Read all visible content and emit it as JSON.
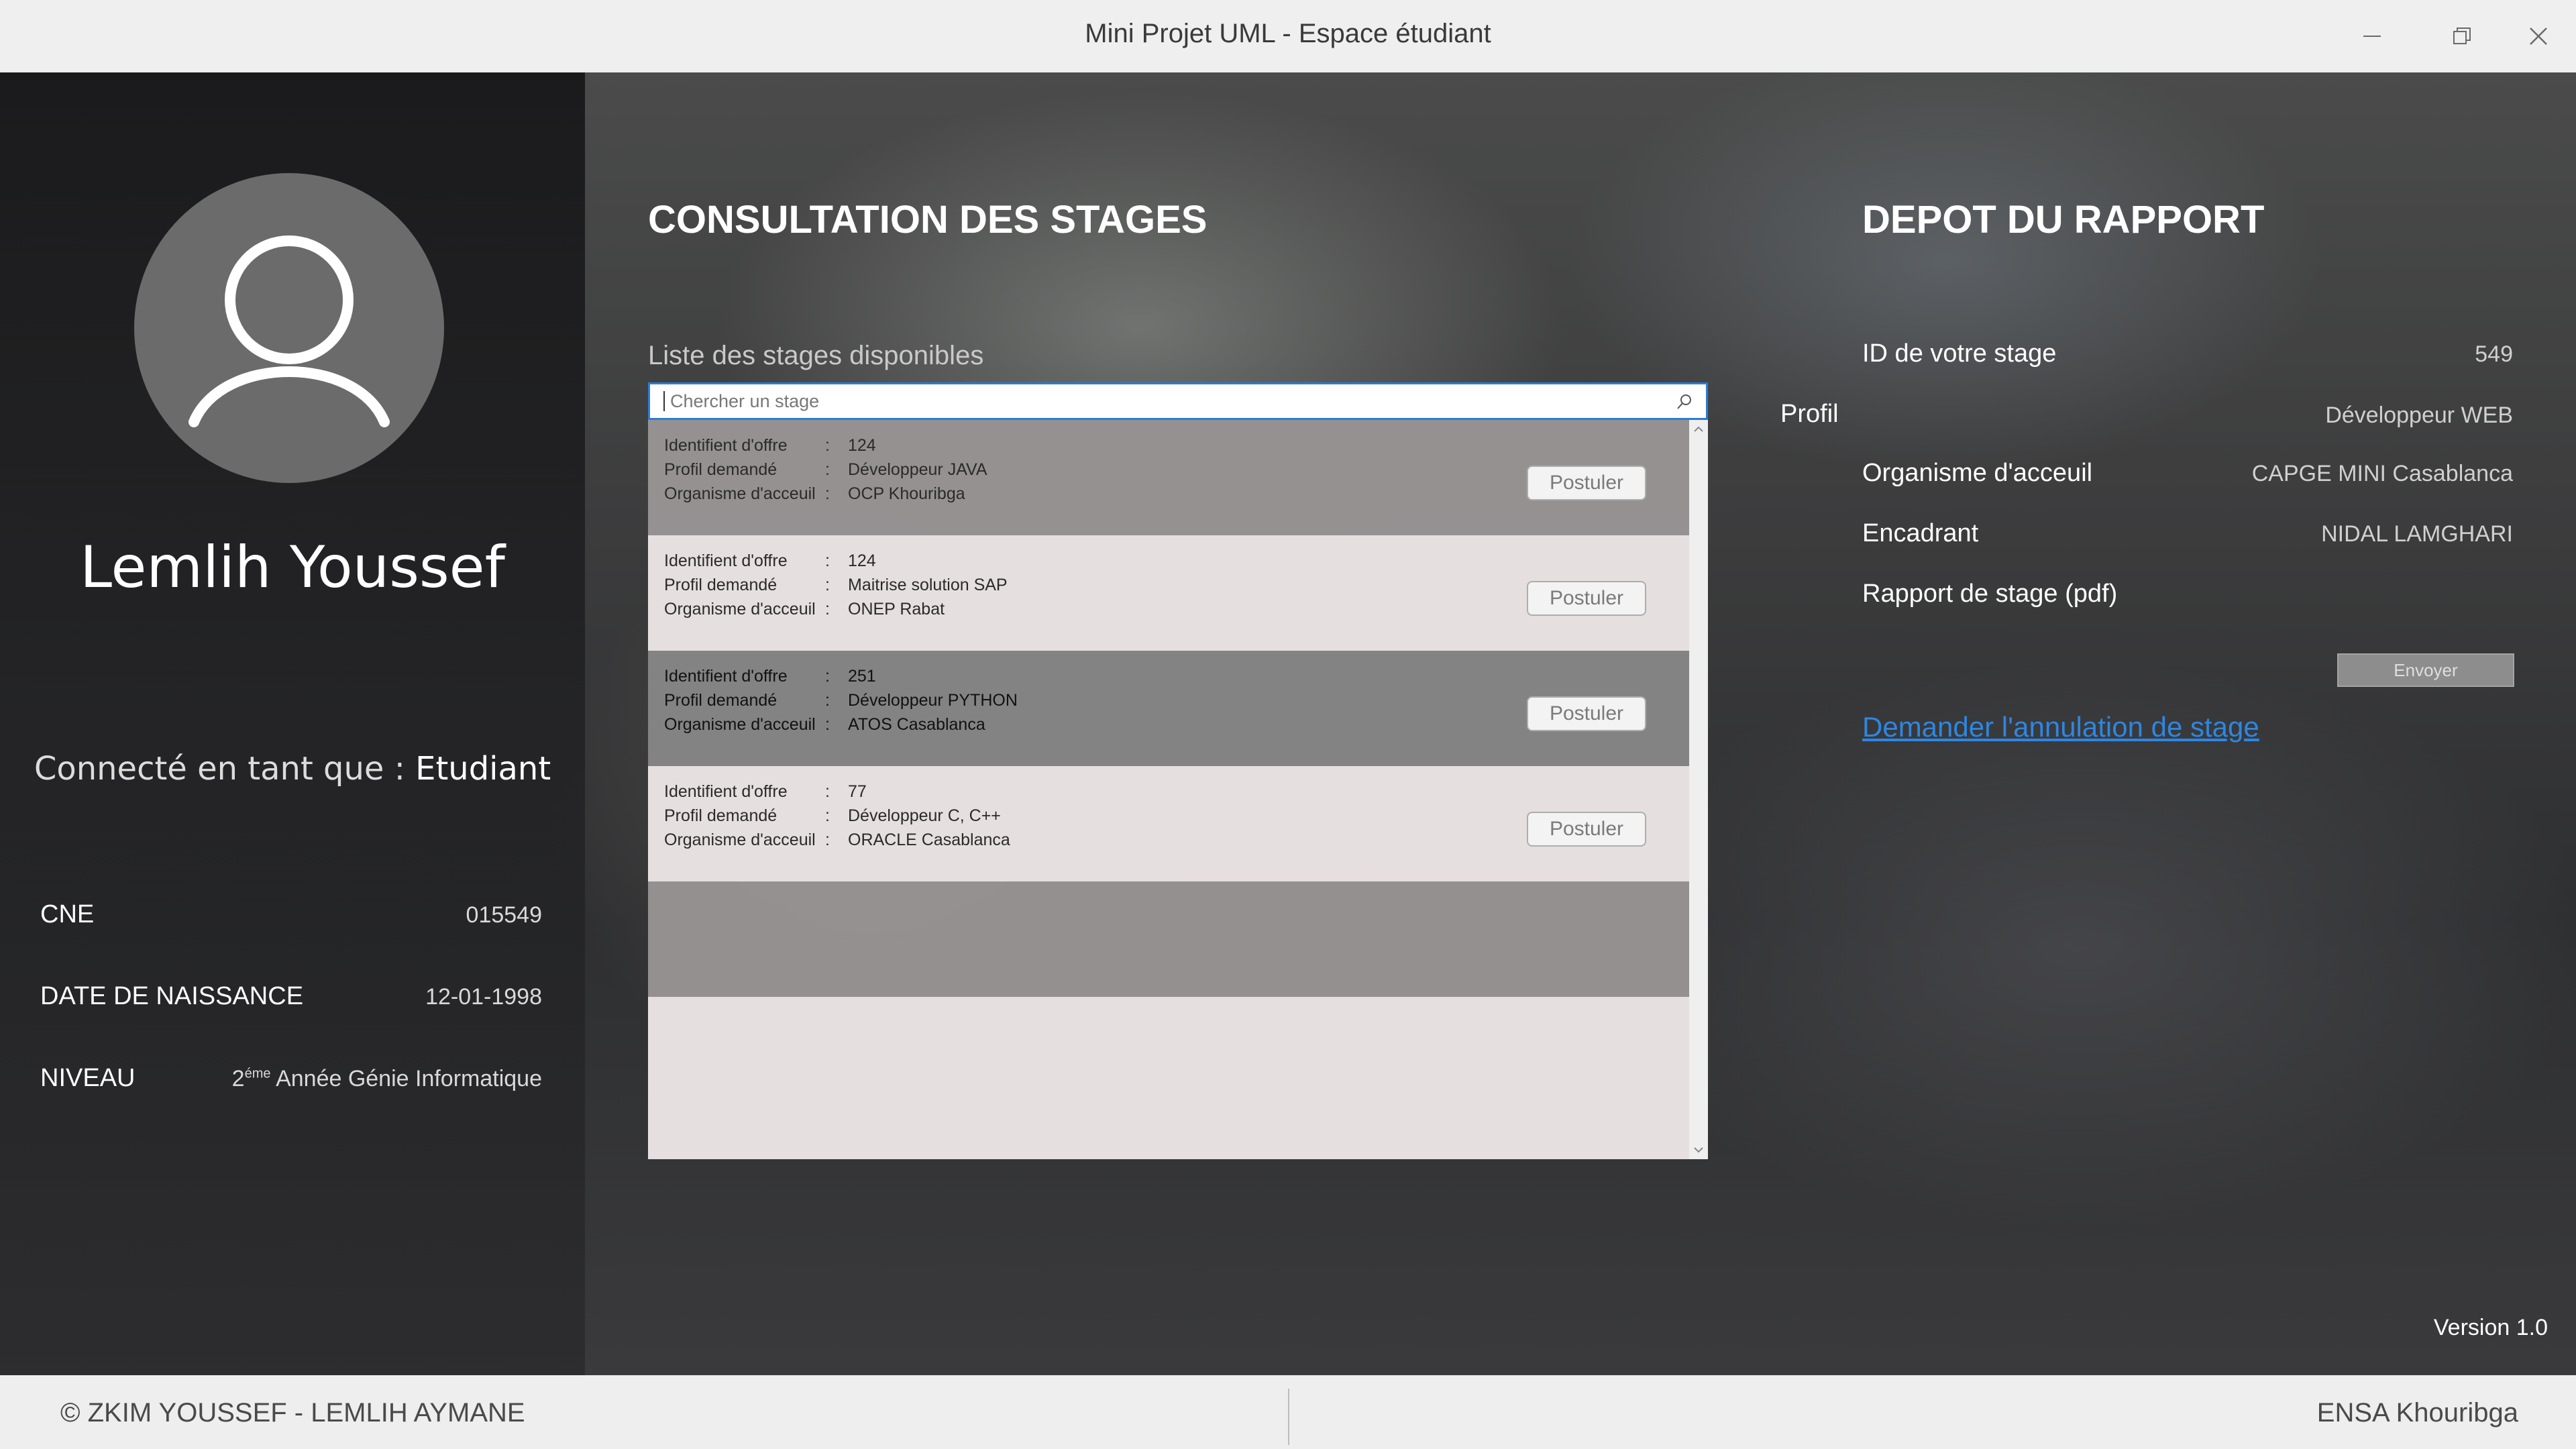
{
  "window": {
    "title": "Mini Projet UML - Espace étudiant",
    "minimize_icon": "minimize-icon",
    "restore_icon": "restore-icon",
    "close_icon": "close-icon"
  },
  "sidebar": {
    "avatar_icon": "user-icon",
    "name": "Lemlih Youssef",
    "role_prefix": "Connecté en tant que : ",
    "role_value": "Etudiant",
    "fields": [
      {
        "label": "CNE",
        "value": "015549"
      },
      {
        "label": "DATE DE NAISSANCE",
        "value": "12-01-1998"
      },
      {
        "label": "NIVEAU",
        "value_sup_prefix": "2",
        "value_sup": "éme",
        "value_rest": " Année Génie Informatique"
      }
    ]
  },
  "consultation": {
    "title": "CONSULTATION DES STAGES",
    "list_label": "Liste des stages disponibles",
    "search_placeholder": "Chercher un stage",
    "search_icon": "search-icon",
    "labels": {
      "id": "Identifient d'offre",
      "profil": "Profil demandé",
      "org": "Organisme d'acceuil",
      "sep": ": "
    },
    "offers": [
      {
        "id": "124",
        "profil": "Développeur JAVA",
        "org": "OCP Khouribga",
        "button": "Postuler"
      },
      {
        "id": "124",
        "profil": "Maitrise solution SAP",
        "org": "ONEP Rabat",
        "button": "Postuler"
      },
      {
        "id": "251",
        "profil": "Développeur PYTHON",
        "org": "ATOS Casablanca",
        "button": "Postuler"
      },
      {
        "id": "77",
        "profil": "Développeur C, C++",
        "org": "ORACLE Casablanca",
        "button": "Postuler"
      }
    ]
  },
  "depot": {
    "title": "DEPOT DU RAPPORT",
    "id_label": "ID de votre stage",
    "id_value": "549",
    "profil_label": "Profil",
    "profil_value": "Développeur WEB",
    "org_label": "Organisme d'acceuil",
    "org_value": "CAPGE MINI Casablanca",
    "encadrant_label": "Encadrant",
    "encadrant_value": "NIDAL LAMGHARI",
    "rapport_label": "Rapport de stage (pdf)",
    "envoyer_label": "Envoyer",
    "cancel_link": "Demander l'annulation de stage"
  },
  "version": "Version 1.0",
  "footer": {
    "left": "© ZKIM YOUSSEF - LEMLIH AYMANE",
    "right": "ENSA Khouribga"
  },
  "colors": {
    "accent": "#2b7bd6",
    "link": "#2e86e0"
  }
}
